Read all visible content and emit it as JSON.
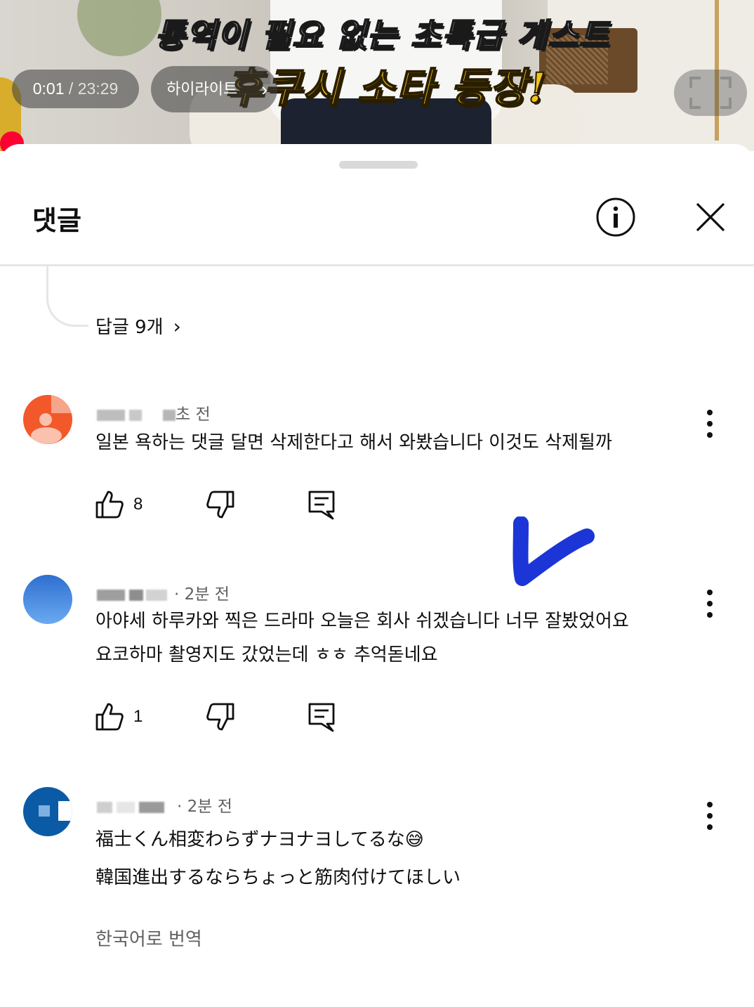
{
  "video": {
    "caption_line1": "통역이 필요 없는 초특급 게스트",
    "caption_line2": "후쿠시 소타 등장!",
    "time_current": "0:01",
    "time_separator": " / ",
    "time_total": "23:29",
    "highlight_label": "하이라이트",
    "colors": {
      "progress": "#ff0033",
      "caption_accent": "#f3c318"
    }
  },
  "sheet": {
    "title": "댓글",
    "replies_link": "답글 9개"
  },
  "comments": [
    {
      "time": "초 전",
      "text_lines": [
        "일본 욕하는 댓글 달면 삭제한다고 해서 와봤습니다 이것도 삭제될까"
      ],
      "likes": "8",
      "avatar_color": "#f2582a"
    },
    {
      "time": "· 2분 전",
      "text_lines": [
        "아야세 하루카와 찍은 드라마 오늘은 회사 쉬겠습니다 너무 잘봤었어요",
        "요코하마 촬영지도 갔었는데 ㅎㅎ 추억돋네요"
      ],
      "likes": "1",
      "avatar_color": "#3a7fd9"
    },
    {
      "time": "· 2분 전",
      "text_lines": [
        "福士くん相変わらずナヨナヨしてるな😅",
        "韓国進出するならちょっと筋肉付けてほしい"
      ],
      "translate_label": "한국어로 번역",
      "avatar_color": "#0b5aa6"
    }
  ],
  "annotation": {
    "checkmark_color": "#1c35d6"
  }
}
